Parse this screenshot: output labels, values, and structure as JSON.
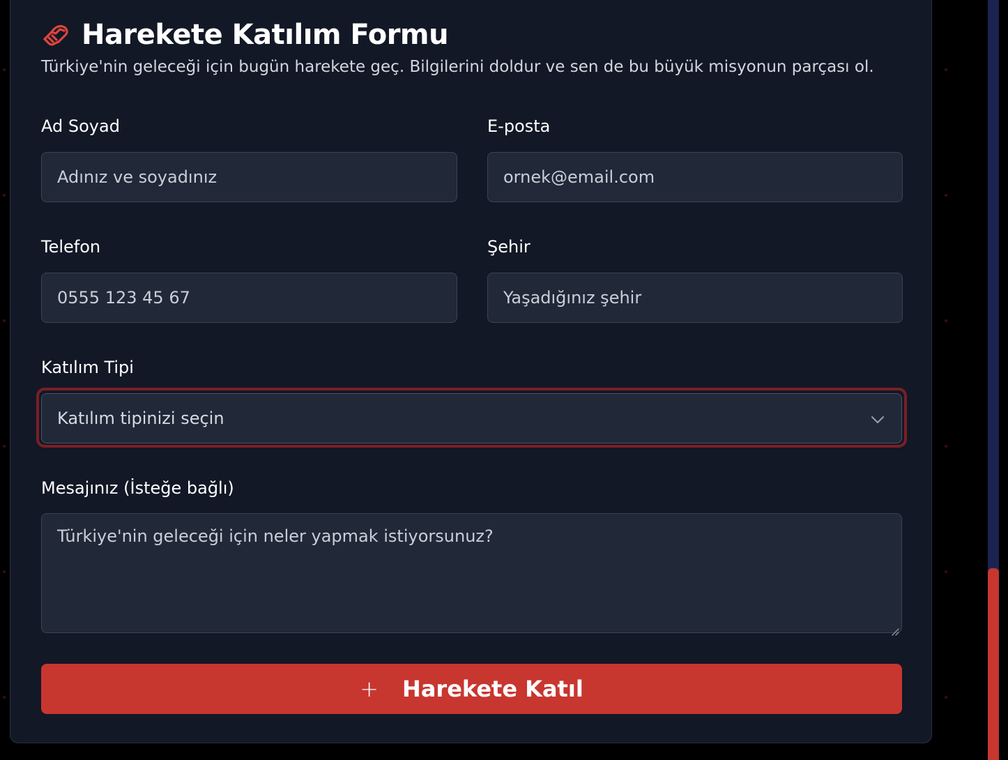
{
  "form": {
    "title": "Harekete Katılım Formu",
    "subtitle": "Türkiye'nin geleceği için bugün harekete geç. Bilgilerini doldur ve sen de bu büyük misyonun parçası ol.",
    "title_icon": "handshake-icon",
    "fields": {
      "name": {
        "label": "Ad Soyad",
        "placeholder": "Adınız ve soyadınız"
      },
      "email": {
        "label": "E-posta",
        "placeholder": "ornek@email.com"
      },
      "phone": {
        "label": "Telefon",
        "placeholder": "0555 123 45 67"
      },
      "city": {
        "label": "Şehir",
        "placeholder": "Yaşadığınız şehir"
      },
      "participation": {
        "label": "Katılım Tipi",
        "selected": "Katılım tipinizi seçin"
      },
      "message": {
        "label": "Mesajınız (İsteğe bağlı)",
        "placeholder": "Türkiye'nin geleceği için neler yapmak istiyorsunuz?"
      }
    },
    "submit": {
      "icon": "+",
      "label": "Harekete Katıl"
    }
  },
  "colors": {
    "background": "#000000",
    "card": "#121826",
    "input": "#212837",
    "accent": "#c83630",
    "focus_ring": "#7a1f26",
    "scrollbar_track": "#1b2450"
  }
}
